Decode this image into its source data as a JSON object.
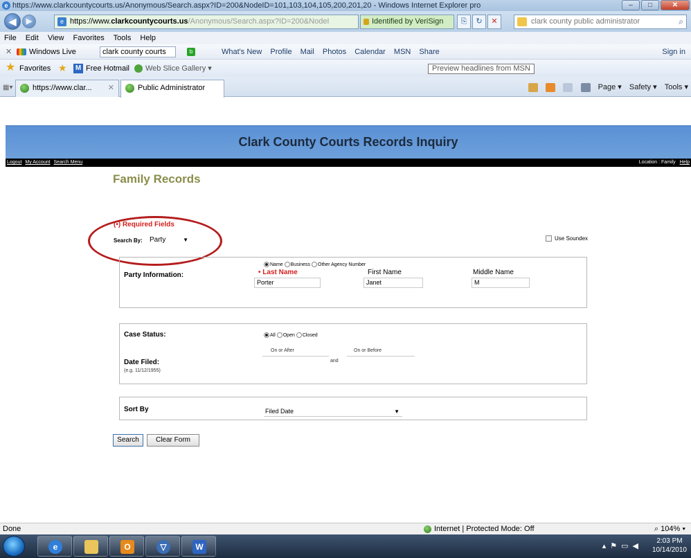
{
  "window": {
    "title": "https://www.clarkcountycourts.us/Anonymous/Search.aspx?ID=200&NodeID=101,103,104,105,200,201,20 - Windows Internet Explorer pro"
  },
  "address": {
    "prefix": "https://www.",
    "domain": "clarkcountycourts.us",
    "rest": "/Anonymous/Search.aspx?ID=200&NodeI",
    "certificate": "Identified by VeriSign",
    "search_value": "clark county public administrator"
  },
  "menu": [
    "File",
    "Edit",
    "View",
    "Favorites",
    "Tools",
    "Help"
  ],
  "live_toolbar": {
    "label": "Windows Live",
    "search_value": "clark county courts",
    "links": [
      "What's New",
      "Profile",
      "Mail",
      "Photos",
      "Calendar",
      "MSN",
      "Share"
    ],
    "signin": "Sign in"
  },
  "favorites_bar": {
    "label": "Favorites",
    "items": [
      "Free Hotmail",
      "Web Slice Gallery ▾"
    ],
    "tooltip": "Preview headlines from MSN"
  },
  "tabs": [
    {
      "label": "https://www.clar..."
    },
    {
      "label": "Public Administrator"
    }
  ],
  "command_bar": {
    "page": "Page ▾",
    "safety": "Safety ▾",
    "tools": "Tools ▾"
  },
  "page": {
    "banner_title": "Clark County Courts Records Inquiry",
    "nav_links": [
      "Logout",
      "My Account",
      "Search Menu"
    ],
    "location": "Location : Family",
    "help": "Help",
    "section_title": "Family Records",
    "required_note": "(•) Required Fields",
    "search_by_label": "Search By:",
    "search_by_value": "Party",
    "soundex_label": "Use Soundex",
    "party": {
      "heading": "Party Information:",
      "radio_options": [
        "Name",
        "Business",
        "Other Agency Number"
      ],
      "selected_radio": "Name",
      "last_name_label": "• Last Name",
      "first_name_label": "First Name",
      "middle_name_label": "Middle Name",
      "last_name_value": "Porter",
      "first_name_value": "Janet",
      "middle_name_value": "M"
    },
    "case": {
      "status_label": "Case Status:",
      "status_options": [
        "All",
        "Open",
        "Closed"
      ],
      "selected_status": "All",
      "date_filed_label": "Date Filed:",
      "date_hint": "(e.g. 11/12/1955)",
      "on_or_after": "On or After",
      "on_or_before": "On or Before",
      "and_label": "and"
    },
    "sort": {
      "label": "Sort By",
      "value": "Filed Date"
    },
    "buttons": {
      "search": "Search",
      "clear": "Clear Form"
    }
  },
  "status_bar": {
    "left": "Done",
    "zone": "Internet | Protected Mode: Off",
    "zoom": "104%"
  },
  "taskbar": {
    "time": "2:03 PM",
    "date": "10/14/2010"
  },
  "colors": {
    "banner": "#5d93d6",
    "section_title": "#8a8d4a",
    "required_red": "#d41f1f",
    "annotation_circle": "#b41d1d"
  }
}
